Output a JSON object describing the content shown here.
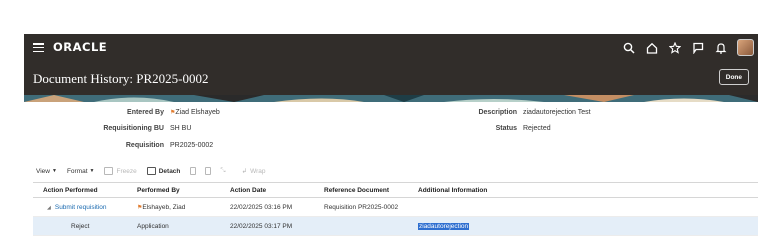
{
  "topbar": {
    "logo": "ORACLE",
    "icons": [
      "menu-icon",
      "search-icon",
      "home-icon",
      "star-icon",
      "flag-icon",
      "bell-icon",
      "avatar"
    ]
  },
  "title_bar": {
    "title": "Document History: PR2025-0002",
    "done_label": "Done"
  },
  "details": {
    "entered_by_label": "Entered By",
    "entered_by": "Ziad Elshayeb",
    "bu_label": "Requisitioning BU",
    "bu": "SH BU",
    "requisition_label": "Requisition",
    "requisition": "PR2025-0002",
    "description_label": "Description",
    "description": "ziadautorejection Test",
    "status_label": "Status",
    "status": "Rejected"
  },
  "toolbar": {
    "view": "View",
    "format": "Format",
    "freeze": "Freeze",
    "detach": "Detach",
    "wrap": "Wrap"
  },
  "table": {
    "headers": [
      "Action Performed",
      "Performed By",
      "Action Date",
      "Reference Document",
      "Additional Information"
    ],
    "rows": [
      {
        "action": "Submit requisition",
        "performed_by": "Elshayeb, Ziad",
        "date": "22/02/2025 03:16 PM",
        "reference": "Requisition PR2025-0002",
        "info": ""
      },
      {
        "action": "Reject",
        "performed_by": "Application",
        "date": "22/02/2025 03:17 PM",
        "reference": "",
        "info": "ziadautorejection"
      }
    ]
  },
  "colors": {
    "header_bg": "#312d2a",
    "link": "#1c6bb0",
    "selected_row": "#e4eef8",
    "selection_highlight": "#2f6fd0"
  }
}
